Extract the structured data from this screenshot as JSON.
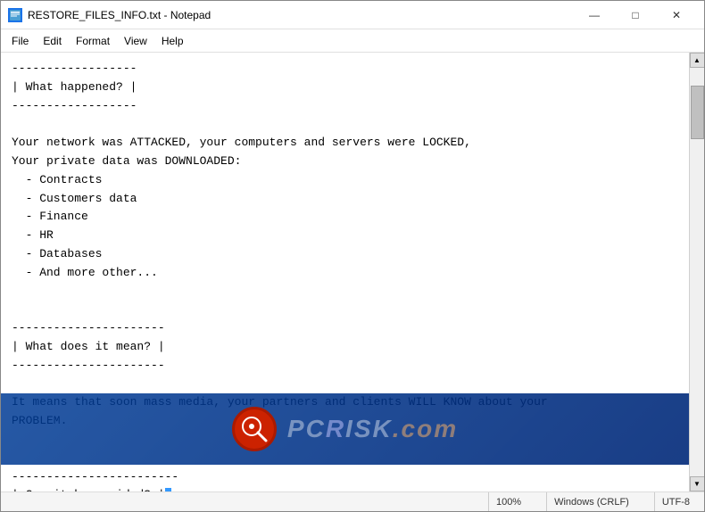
{
  "window": {
    "title": "RESTORE_FILES_INFO.txt - Notepad",
    "icon": "📄"
  },
  "titlebar": {
    "minimize_label": "—",
    "maximize_label": "□",
    "close_label": "✕"
  },
  "menubar": {
    "items": [
      "File",
      "Edit",
      "Format",
      "View",
      "Help"
    ]
  },
  "content": {
    "text": "------------------\n| What happened? |\n------------------\n\nYour network was ATTACKED, your computers and servers were LOCKED,\nYour private data was DOWNLOADED:\n  - Contracts\n  - Customers data\n  - Finance\n  - HR\n  - Databases\n  - And more other...\n\n\n----------------------\n| What does it mean? |\n----------------------\n\nIt means that soon mass media, your partners and clients WILL KNOW about your\nPROBLEM.\n\n\n------------------------\n| Can it be avoided?   |\n------------------------"
  },
  "statusbar": {
    "zoom": "100%",
    "line_ending": "Windows (CRLF)",
    "encoding": "UTF-8"
  },
  "watermark": {
    "site": "PCRISK.COM"
  }
}
